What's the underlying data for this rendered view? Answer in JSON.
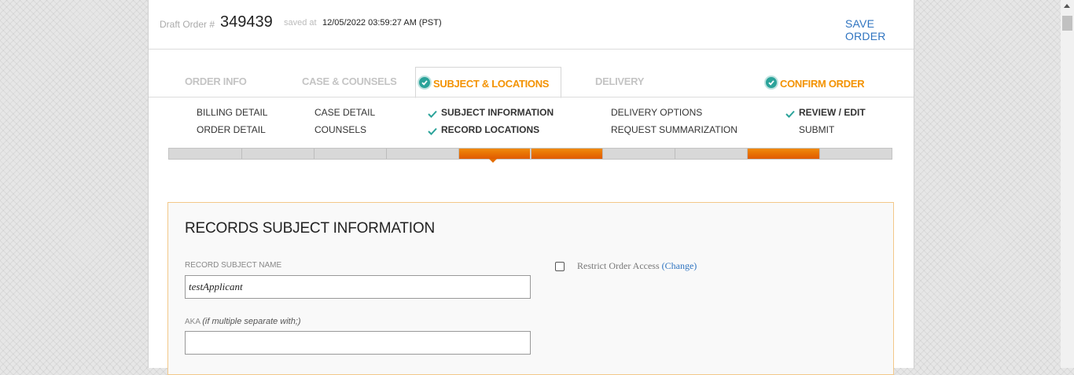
{
  "header": {
    "draft_label": "Draft Order #",
    "order_number": "349439",
    "saved_label": "saved at",
    "saved_time": "12/05/2022 03:59:27 AM (PST)",
    "save_button": "SAVE ORDER"
  },
  "tabs": [
    {
      "label": "ORDER INFO",
      "checked": false,
      "active": false
    },
    {
      "label": "CASE & COUNSELS",
      "checked": false,
      "active": false
    },
    {
      "label": "SUBJECT & LOCATIONS",
      "checked": true,
      "active": true
    },
    {
      "label": "DELIVERY",
      "checked": false,
      "active": false
    },
    {
      "label": "CONFIRM ORDER",
      "checked": true,
      "active": false
    }
  ],
  "subnav": {
    "order_info": [
      "BILLING DETAIL",
      "ORDER DETAIL"
    ],
    "case_counsels": [
      "CASE DETAIL",
      "COUNSELS"
    ],
    "subject_locations": [
      "SUBJECT INFORMATION",
      "RECORD LOCATIONS"
    ],
    "delivery": [
      "DELIVERY OPTIONS",
      "REQUEST SUMMARIZATION"
    ],
    "confirm": [
      "REVIEW / EDIT",
      "SUBMIT"
    ]
  },
  "progress": {
    "total_steps": 10,
    "completed_steps": [
      5,
      6,
      9
    ]
  },
  "colors": {
    "accent": "#f39200",
    "link": "#2f74c0",
    "check": "#2ba39a",
    "panel_border": "#f3c889"
  },
  "form": {
    "title": "RECORDS SUBJECT INFORMATION",
    "subject_label": "RECORD SUBJECT NAME",
    "subject_value": "testApplicant",
    "aka_label": "AKA",
    "aka_hint": "(if multiple separate with;)",
    "aka_value": "",
    "restrict_label": "Restrict Order Access",
    "restrict_link": "(Change)",
    "restrict_checked": false
  }
}
